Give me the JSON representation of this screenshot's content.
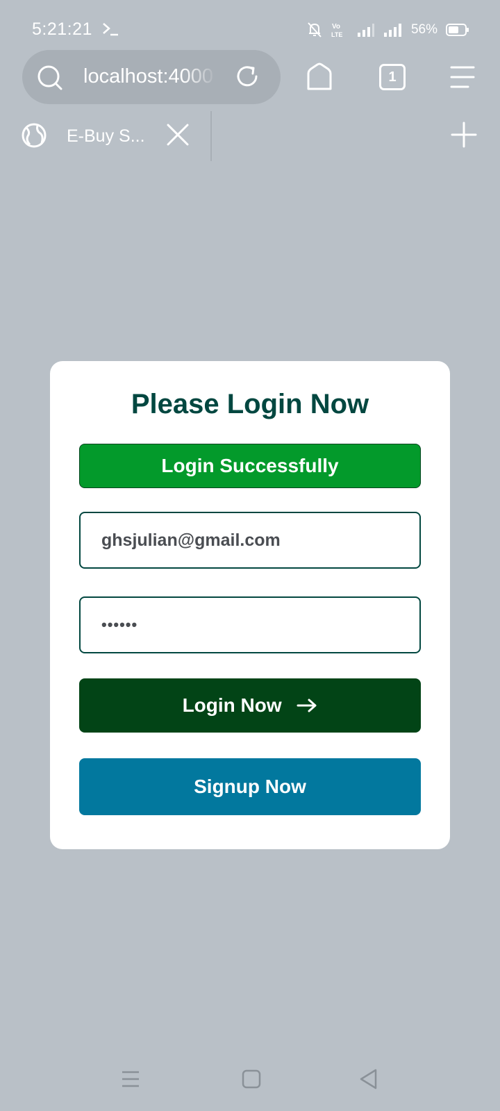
{
  "status_bar": {
    "time": "5:21:21",
    "battery_percent": "56%",
    "icons": [
      "terminal-icon",
      "silent-bell-icon",
      "volte-icon",
      "signal-icon",
      "signal-icon",
      "battery-icon"
    ]
  },
  "browser": {
    "url": "localhost:4000",
    "open_tab_count": "1",
    "tab": {
      "title": "E-Buy S..."
    },
    "icons": [
      "search-icon",
      "reload-icon",
      "home-icon",
      "tabs-icon",
      "menu-icon",
      "globe-icon",
      "close-icon",
      "plus-icon"
    ]
  },
  "login_card": {
    "title": "Please Login Now",
    "alert": "Login Successfully",
    "email_value": "ghsjulian@gmail.com",
    "password_value": "••••••",
    "login_button": "Login Now",
    "signup_button": "Signup Now"
  },
  "nav_bar": {
    "icons": [
      "recent-apps-icon",
      "home-square-icon",
      "back-icon"
    ]
  },
  "colors": {
    "page_background": "#b9c0c7",
    "title": "#024740",
    "alert_bg": "#039a2b",
    "login_button_bg": "#024416",
    "signup_button_bg": "#02789e"
  }
}
